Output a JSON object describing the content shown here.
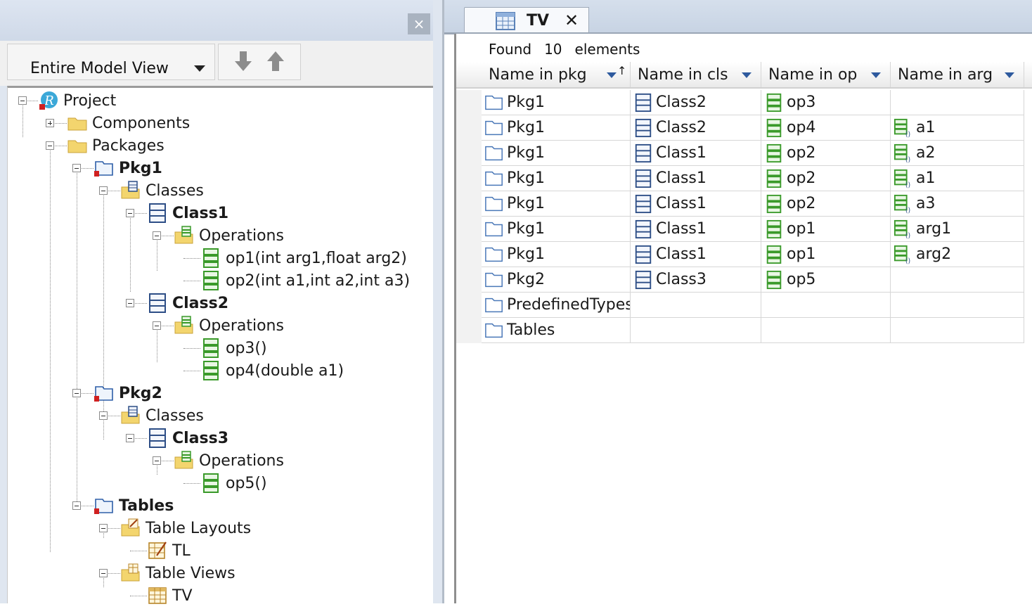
{
  "left_panel": {
    "close_label": "×",
    "view_selector": {
      "label": "Entire Model View"
    },
    "toolbar": {
      "move_down": "move-down",
      "move_up": "move-up"
    },
    "tree": [
      {
        "label": "Project",
        "bold": false,
        "icon": "project-icon"
      },
      {
        "label": "Components",
        "bold": false,
        "icon": "folder-icon"
      },
      {
        "label": "Packages",
        "bold": false,
        "icon": "folder-icon"
      },
      {
        "label": "Pkg1",
        "bold": true,
        "icon": "package-icon"
      },
      {
        "label": "Classes",
        "bold": false,
        "icon": "classes-folder-icon"
      },
      {
        "label": "Class1",
        "bold": true,
        "icon": "class-icon"
      },
      {
        "label": "Operations",
        "bold": false,
        "icon": "operations-folder-icon"
      },
      {
        "label": "op1(int arg1,float arg2)",
        "bold": false,
        "icon": "operation-icon"
      },
      {
        "label": "op2(int a1,int a2,int a3)",
        "bold": false,
        "icon": "operation-icon"
      },
      {
        "label": "Class2",
        "bold": true,
        "icon": "class-icon"
      },
      {
        "label": "Operations",
        "bold": false,
        "icon": "operations-folder-icon"
      },
      {
        "label": "op3()",
        "bold": false,
        "icon": "operation-icon"
      },
      {
        "label": "op4(double a1)",
        "bold": false,
        "icon": "operation-icon"
      },
      {
        "label": "Pkg2",
        "bold": true,
        "icon": "package-icon"
      },
      {
        "label": "Classes",
        "bold": false,
        "icon": "classes-folder-icon"
      },
      {
        "label": "Class3",
        "bold": true,
        "icon": "class-icon"
      },
      {
        "label": "Operations",
        "bold": false,
        "icon": "operations-folder-icon"
      },
      {
        "label": "op5()",
        "bold": false,
        "icon": "operation-icon"
      },
      {
        "label": "Tables",
        "bold": true,
        "icon": "package-icon"
      },
      {
        "label": "Table Layouts",
        "bold": false,
        "icon": "table-layouts-folder-icon"
      },
      {
        "label": "TL",
        "bold": false,
        "icon": "table-layout-icon"
      },
      {
        "label": "Table Views",
        "bold": false,
        "icon": "table-views-folder-icon"
      },
      {
        "label": "TV",
        "bold": false,
        "icon": "table-view-icon"
      }
    ]
  },
  "right_panel": {
    "tab": {
      "label": "TV",
      "close": "✕"
    },
    "found": {
      "prefix": "Found",
      "count": "10",
      "suffix": "elements"
    },
    "columns": [
      "Name in pkg",
      "Name in cls",
      "Name in op",
      "Name in arg"
    ],
    "rows": [
      [
        "Pkg1",
        "Class2",
        "op3",
        ""
      ],
      [
        "Pkg1",
        "Class2",
        "op4",
        "a1"
      ],
      [
        "Pkg1",
        "Class1",
        "op2",
        "a2"
      ],
      [
        "Pkg1",
        "Class1",
        "op2",
        "a1"
      ],
      [
        "Pkg1",
        "Class1",
        "op2",
        "a3"
      ],
      [
        "Pkg1",
        "Class1",
        "op1",
        "arg1"
      ],
      [
        "Pkg1",
        "Class1",
        "op1",
        "arg2"
      ],
      [
        "Pkg2",
        "Class3",
        "op5",
        ""
      ],
      [
        "PredefinedTypes",
        "",
        "",
        ""
      ],
      [
        "Tables",
        "",
        "",
        ""
      ]
    ]
  },
  "colors": {
    "op_green": "#3a9a2a",
    "class_blue": "#2d4e86",
    "folder_yellow": "#e9c45c",
    "package_blue": "#4a78b8"
  }
}
